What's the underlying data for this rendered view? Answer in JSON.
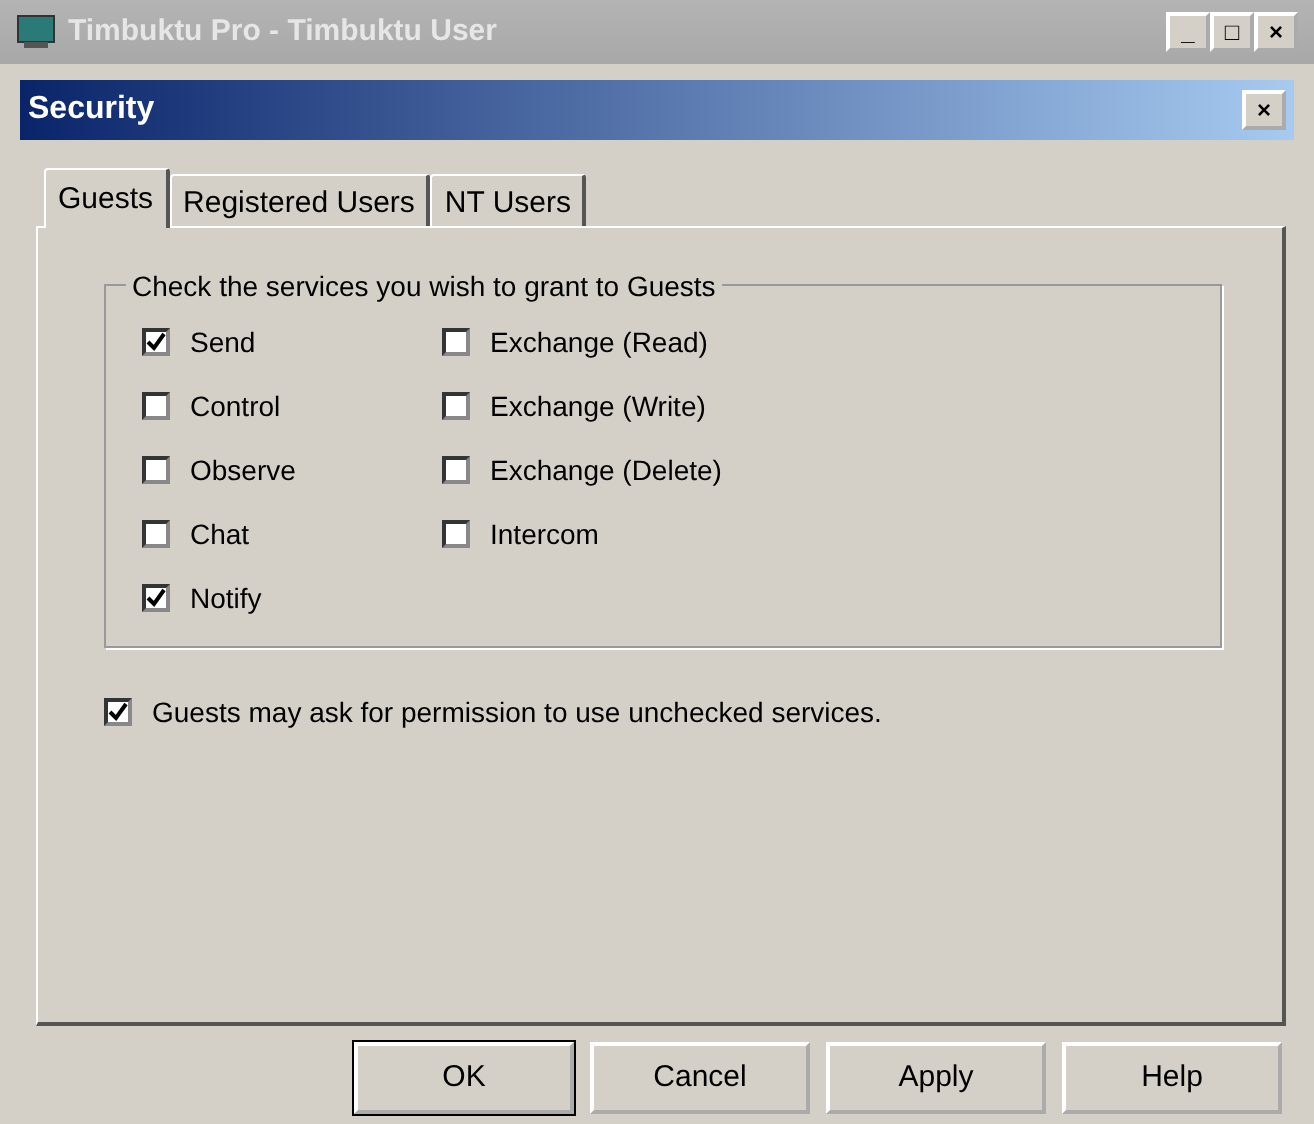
{
  "app_window": {
    "title": "Timbuktu Pro - Timbuktu User",
    "controls": [
      "_",
      "□",
      "×"
    ]
  },
  "dialog": {
    "title": "Security",
    "close": "×"
  },
  "tabs": [
    {
      "label": "Guests",
      "selected": true
    },
    {
      "label": "Registered Users",
      "selected": false
    },
    {
      "label": "NT Users",
      "selected": false
    }
  ],
  "group": {
    "title": "Check the services you wish to grant to Guests",
    "columns": [
      [
        {
          "label": "Send",
          "checked": true
        },
        {
          "label": "Control",
          "checked": false
        },
        {
          "label": "Observe",
          "checked": false
        },
        {
          "label": "Chat",
          "checked": false
        },
        {
          "label": "Notify",
          "checked": true
        }
      ],
      [
        {
          "label": "Exchange (Read)",
          "checked": false
        },
        {
          "label": "Exchange (Write)",
          "checked": false
        },
        {
          "label": "Exchange (Delete)",
          "checked": false
        },
        {
          "label": "Intercom",
          "checked": false
        }
      ]
    ]
  },
  "permission": {
    "label": "Guests may ask for permission to use unchecked services.",
    "checked": true
  },
  "buttons": [
    {
      "label": "OK",
      "default": true
    },
    {
      "label": "Cancel",
      "default": false
    },
    {
      "label": "Apply",
      "default": false
    },
    {
      "label": "Help",
      "default": false
    }
  ]
}
